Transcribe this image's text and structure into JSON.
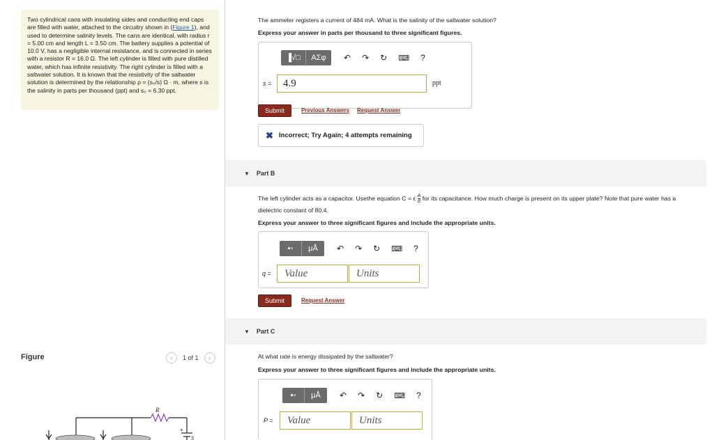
{
  "problem": {
    "text_before_link": "Two cylindrical cans with insulating sides and conducting end caps are filled with water, attached to the circuitry shown in (",
    "link": "Figure 1",
    "text_after_link": "), and used to determine salinity levels. The cans are identical, with radius r = 5.00 cm and length L = 3.50 cm. The battery supplies a potential of 10.0 V, has a negligible internal resistance, and is connected in series with a resistor R = 16.0 Ω. The left cylinder is filled with pure distilled water, which has infinite resistivity. The right cylinder is filled with a saltwater solution. It is known that the resistivity of the saltwater solution is determined by the relationship ρ = (s₀/s) Ω · m, where s is the salinity in parts per thousand (ppt) and s₀ = 6.30 ppt."
  },
  "figure": {
    "label": "Figure",
    "pager": "1 of 1",
    "resistor_label": "R",
    "battery_plus": "+",
    "battery_s": "S"
  },
  "partA": {
    "question": "The ammeter registers a current of 484 mA. What is the salinity of the saltwater solution?",
    "instruction": "Express your answer in parts per thousand to three significant figures.",
    "toolbar_btn1": "▐√□",
    "toolbar_btn2": "ΑΣφ",
    "var": "s =",
    "value": "4.9",
    "unit": "ppt",
    "submit": "Submit",
    "previous_answers": "Previous Answers",
    "request_answer": "Request Answer",
    "feedback": "Incorrect; Try Again; 4 attempts remaining"
  },
  "partB": {
    "header": "Part B",
    "question_pre": "The left cylinder acts as a capacitor. Usethe equation C = ϵ",
    "frac_num": "A",
    "frac_den": "d",
    "question_post": " for its capacitance. How much charge is present on its upper plate? Note that pure water has a",
    "question_line2": "dielectric constant of 80.4.",
    "instruction": "Express your answer to three significant figures and include the appropriate units.",
    "toolbar_btn2": "μÅ",
    "var": "q =",
    "value_placeholder": "Value",
    "units_placeholder": "Units",
    "submit": "Submit",
    "request_answer": "Request Answer"
  },
  "partC": {
    "header": "Part C",
    "question": "At what rate is energy dissipated by the saltwater?",
    "instruction": "Express your answer to three significant figures and include the appropriate units.",
    "toolbar_btn2": "μÅ",
    "var": "P =",
    "value_placeholder": "Value",
    "units_placeholder": "Units"
  },
  "icons": {
    "undo": "↶",
    "redo": "↷",
    "reset": "↻",
    "keyboard": "⌨",
    "help": "?"
  }
}
